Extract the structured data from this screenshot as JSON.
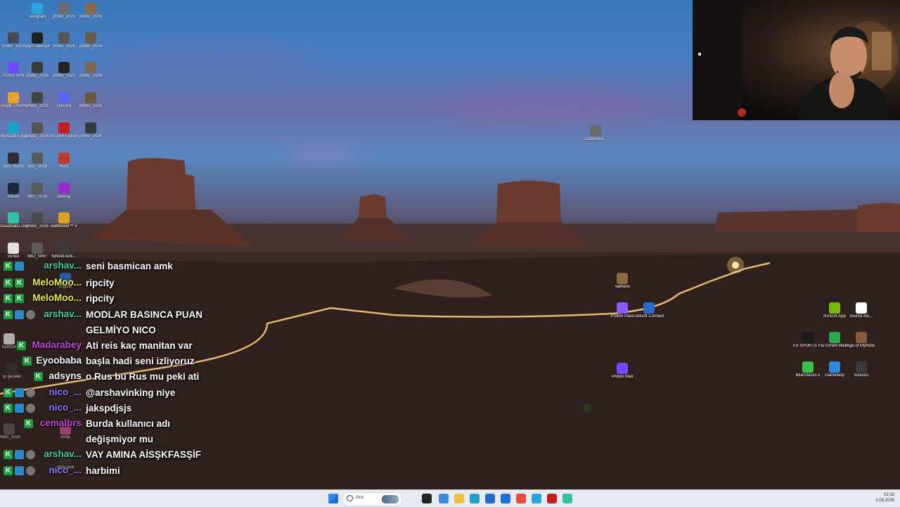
{
  "desktop": {
    "icons_left": [
      {
        "label": "Telegram",
        "color": "#2aa3e0"
      },
      {
        "label": "photo_2026",
        "color": "#6a6a70"
      },
      {
        "label": "photo_2026",
        "color": "#8a6a4a"
      },
      {
        "label": "photo_2026",
        "color": "#4a4a55"
      },
      {
        "label": "yayin basliyor",
        "color": "#222"
      },
      {
        "label": "photo_2026",
        "color": "#555"
      },
      {
        "label": "photo_2026",
        "color": "#6a5a4a"
      },
      {
        "label": "Proton VPN",
        "color": "#6d4aff"
      },
      {
        "label": "photo_2026",
        "color": "#3a3a3a"
      },
      {
        "label": "photo_2026",
        "color": "#222"
      },
      {
        "label": "photo_2026",
        "color": "#7a6a50"
      },
      {
        "label": "Google Chrome",
        "color": "#e8a32a"
      },
      {
        "label": "photo_2026",
        "color": "#444"
      },
      {
        "label": "Discord",
        "color": "#5865f2"
      },
      {
        "label": "photo_2026",
        "color": "#6a5a40"
      },
      {
        "label": "Microsoft Edge",
        "color": "#1fa0c8"
      },
      {
        "label": "photo_2026",
        "color": "#555"
      },
      {
        "label": "AIDA64 Extreme",
        "color": "#c02020"
      },
      {
        "label": "photo_2026",
        "color": "#3a3a3a"
      },
      {
        "label": "OBS Studio",
        "color": "#302e31"
      },
      {
        "label": "IMG_2018",
        "color": "#5a5a5a"
      },
      {
        "label": "Rust",
        "color": "#c03a2a"
      },
      {
        "label": "Steam",
        "color": "#1b2838"
      },
      {
        "label": "IMG_2538",
        "color": "#5a5a5a"
      },
      {
        "label": "overlay",
        "color": "#9a2ad0"
      },
      {
        "label": "Streamlabs Desktop",
        "color": "#31c3a2"
      },
      {
        "label": "photo_2026",
        "color": "#4a4a4a"
      },
      {
        "label": "Battlefield™ V",
        "color": "#e0a020"
      },
      {
        "label": "Vortex",
        "color": "#e0e0e0"
      },
      {
        "label": "IMG_5067",
        "color": "#5a5a5a"
      },
      {
        "label": "turkish-turk...",
        "color": "#3a3a3a"
      }
    ],
    "icons_right": [
      {
        "label": "13386468...",
        "color": "#6a6a70"
      },
      {
        "label": "Valheim",
        "color": "#8a6a3a"
      },
      {
        "label": "Proton Pass",
        "color": "#8a5aff"
      },
      {
        "label": "Ubisoft Connect",
        "color": "#2a6ad0"
      },
      {
        "label": "Proton Mail",
        "color": "#6d4aff"
      },
      {
        "label": "NVIDIA App",
        "color": "#76b900"
      },
      {
        "label": "source-rec...",
        "color": "#ffffff"
      },
      {
        "label": "EA SPORTS FC™ 26",
        "color": "#1a1a1a"
      },
      {
        "label": "uTorrent Web",
        "color": "#2aa84a"
      },
      {
        "label": "Age of Mytholo...",
        "color": "#8a5a3a"
      },
      {
        "label": "BlueStacks 5",
        "color": "#3ac04a"
      },
      {
        "label": "Gameloop",
        "color": "#2a8ae0"
      },
      {
        "label": "lucescu",
        "color": "#3a3a3a"
      }
    ],
    "icons_misc": [
      {
        "label": "harmon",
        "color": "#ddd"
      },
      {
        "label": "iyi geceler",
        "color": "#333"
      },
      {
        "label": "photo_2026",
        "color": "#555"
      },
      {
        "label": "insta",
        "color": "#c04a8a"
      },
      {
        "label": "attila kick",
        "color": "#333"
      },
      {
        "label": "Engine",
        "color": "#2a6ad0"
      }
    ]
  },
  "chat": {
    "messages": [
      {
        "user": "arshav...",
        "user_color": "#4ad0a0",
        "text": "seni basmican amk",
        "badges": [
          "k",
          "b2"
        ]
      },
      {
        "user": "MeloMoo...",
        "user_color": "#e8f04a",
        "text": "ripcity",
        "badges": [
          "k",
          "k"
        ]
      },
      {
        "user": "MeloMoo...",
        "user_color": "#e8f04a",
        "text": "ripcity",
        "badges": [
          "k",
          "k"
        ]
      },
      {
        "user": "arshav...",
        "user_color": "#4ad0a0",
        "text": "MODLAR BASINCA PUAN",
        "badges": [
          "k",
          "b2",
          "b3"
        ]
      },
      {
        "user": "",
        "user_color": "#ffffff",
        "text": "GELMİYO NICO",
        "badges": []
      },
      {
        "user": "Madarabey",
        "user_color": "#c04ad0",
        "text": "Ati reis kaç manitan var",
        "badges": [
          "k"
        ]
      },
      {
        "user": "Eyoobaba",
        "user_color": "#ffffff",
        "text": "başla hadi seni izliyoruz",
        "badges": [
          "k"
        ]
      },
      {
        "user": "adsyns",
        "user_color": "#ffffff",
        "text": "o Rus bu Rus mu peki ati",
        "badges": [
          "k"
        ]
      },
      {
        "user": "nico_...",
        "user_color": "#8a7aff",
        "text": "@arshavinking niye",
        "badges": [
          "k",
          "b2",
          "b3"
        ]
      },
      {
        "user": "nico_...",
        "user_color": "#8a7aff",
        "text": "jakspdjsjs",
        "badges": [
          "k",
          "b2",
          "b3"
        ]
      },
      {
        "user": "cemalbrs",
        "user_color": "#c04ad0",
        "text": "Burda kullanıcı adı",
        "badges": [
          "k"
        ]
      },
      {
        "user": "",
        "user_color": "#ffffff",
        "text": "değişmiyor mu",
        "badges": []
      },
      {
        "user": "arshav...",
        "user_color": "#4ad0a0",
        "text": "VAY AMINA AİSŞKFASŞİF",
        "badges": [
          "k",
          "b2",
          "b3"
        ]
      },
      {
        "user": "nico_...",
        "user_color": "#8a7aff",
        "text": "harbimi",
        "badges": [
          "k",
          "b2",
          "b3"
        ]
      }
    ]
  },
  "taskbar": {
    "search_placeholder": "Ara",
    "apps": [
      {
        "name": "start-icon",
        "color": "#1e6fd9"
      },
      {
        "name": "file-explorer-icon",
        "color": "#222"
      },
      {
        "name": "copilot-icon",
        "color": "#3a8ae0"
      },
      {
        "name": "folder-icon",
        "color": "#f0c040"
      },
      {
        "name": "edge-icon",
        "color": "#1fa0c8"
      },
      {
        "name": "store-icon",
        "color": "#2a6ad0"
      },
      {
        "name": "outlook-icon",
        "color": "#1e6fd9"
      },
      {
        "name": "chrome-icon",
        "color": "#e84a3a"
      },
      {
        "name": "telegram-icon",
        "color": "#2aa3e0"
      },
      {
        "name": "game-icon",
        "color": "#c02020"
      },
      {
        "name": "streamlabs-icon",
        "color": "#31c3a2"
      }
    ],
    "time": "02:33",
    "date": "2.08.2026"
  }
}
